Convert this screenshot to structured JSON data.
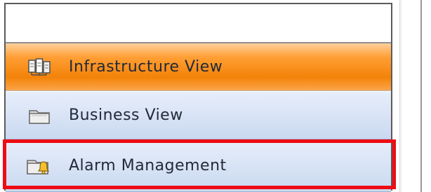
{
  "navigation": {
    "items": [
      {
        "label": "Infrastructure View",
        "icon": "network-devices-icon",
        "state": "active"
      },
      {
        "label": "Business View",
        "icon": "folder-icon",
        "state": "normal"
      },
      {
        "label": "Alarm Management",
        "icon": "alarm-folder-icon",
        "state": "highlighted"
      }
    ]
  },
  "colors": {
    "active_background": "#f38309",
    "normal_background": "#cad9f0",
    "highlight_border": "#ef0c14",
    "label_text": "#222a38"
  }
}
